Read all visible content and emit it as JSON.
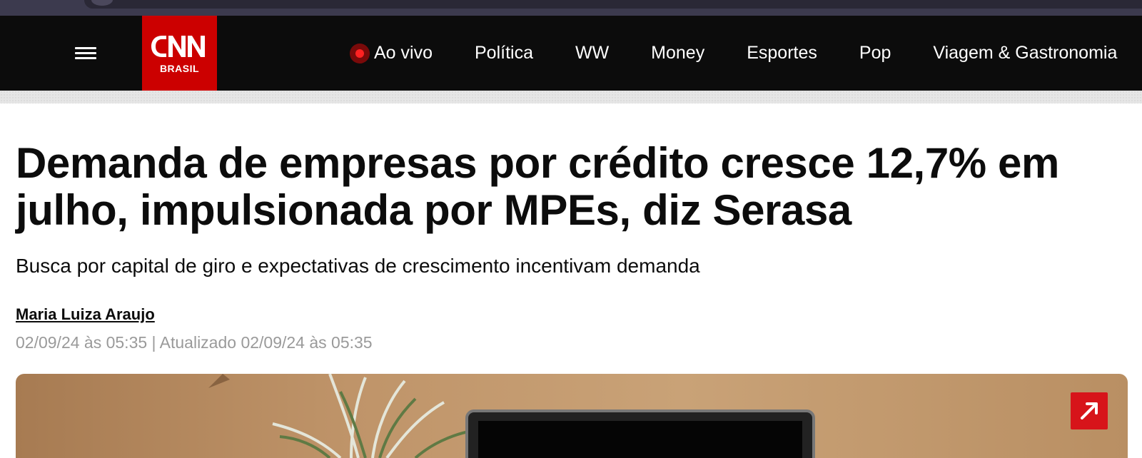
{
  "header": {
    "menu_icon": "hamburger-menu-icon",
    "logo": {
      "wordmark": "CNN",
      "subtitle": "BRASIL",
      "bg_color": "#cc0000"
    },
    "nav": [
      {
        "label": "Ao vivo",
        "icon": "live-dot-icon"
      },
      {
        "label": "Política"
      },
      {
        "label": "WW"
      },
      {
        "label": "Money"
      },
      {
        "label": "Esportes"
      },
      {
        "label": "Pop"
      },
      {
        "label": "Viagem & Gastronomia"
      }
    ]
  },
  "article": {
    "headline": "Demanda de empresas por crédito cresce 12,7% em julho, impulsionada por MPEs, diz Serasa",
    "subheadline": "Busca por capital de giro e expectativas de crescimento incentivam demanda",
    "author": "Maria Luiza Araujo",
    "timestamp": "02/09/24 às 05:35 | Atualizado 02/09/24 às 05:35",
    "image_action_icon": "expand-arrow-icon"
  },
  "colors": {
    "accent": "#cc0000",
    "nav_bg": "#0c0c0c",
    "meta_text": "#9a9a9a"
  }
}
